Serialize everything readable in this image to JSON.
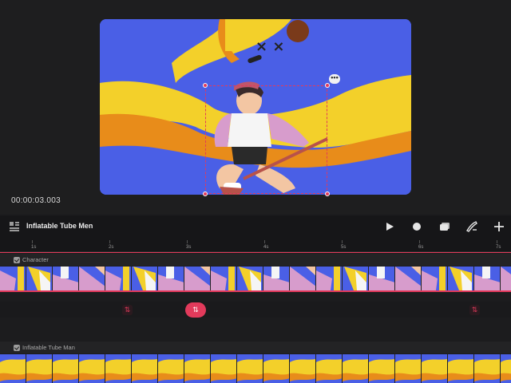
{
  "canvas": {
    "timecode": "00:00:03.003",
    "more_label": "•••"
  },
  "toolbar": {
    "project_title": "Inflatable Tube Men",
    "tools": [
      "play-icon",
      "record-icon",
      "frames-icon",
      "draw-icon",
      "add-icon"
    ]
  },
  "ruler": {
    "labels": [
      "1s",
      "2s",
      "3s",
      "4s",
      "5s",
      "6s",
      "7s"
    ]
  },
  "tracks": [
    {
      "name": "Character",
      "checked": true
    },
    {
      "name": "Inflatable Tube Man",
      "checked": true
    }
  ],
  "colors": {
    "accent": "#e23a5b",
    "background": "#1c1c1e",
    "sky": "#4a5fe6",
    "tube_yellow": "#f7e23a"
  }
}
